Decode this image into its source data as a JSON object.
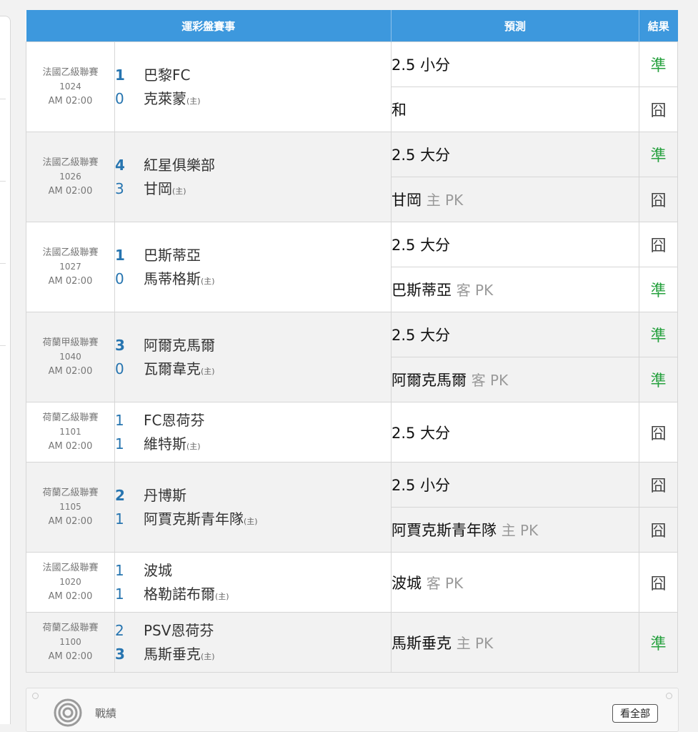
{
  "table": {
    "headers": {
      "match": "運彩盤賽事",
      "prediction": "預測",
      "result": "結果"
    },
    "host_marker": "(主)",
    "rows": [
      {
        "league": "法國乙級聯賽",
        "date": "1024",
        "time": "AM 02:00",
        "teams": [
          {
            "score": "1",
            "name": "巴黎FC",
            "host": false,
            "win": true
          },
          {
            "score": "0",
            "name": "克萊蒙",
            "host": true,
            "win": false
          }
        ],
        "predictions": [
          {
            "text": "2.5 小分",
            "side": "",
            "kind": "",
            "result": "準",
            "ok": true
          },
          {
            "text": "和",
            "side": "",
            "kind": "",
            "result": "囧",
            "ok": false
          }
        ]
      },
      {
        "league": "法國乙級聯賽",
        "date": "1026",
        "time": "AM 02:00",
        "teams": [
          {
            "score": "4",
            "name": "紅星俱樂部",
            "host": false,
            "win": true
          },
          {
            "score": "3",
            "name": "甘岡",
            "host": true,
            "win": false
          }
        ],
        "predictions": [
          {
            "text": "2.5 大分",
            "side": "",
            "kind": "",
            "result": "準",
            "ok": true
          },
          {
            "text": "",
            "side": "甘岡",
            "kind": "主 PK",
            "result": "囧",
            "ok": false
          }
        ]
      },
      {
        "league": "法國乙級聯賽",
        "date": "1027",
        "time": "AM 02:00",
        "teams": [
          {
            "score": "1",
            "name": "巴斯蒂亞",
            "host": false,
            "win": true
          },
          {
            "score": "0",
            "name": "馬蒂格斯",
            "host": true,
            "win": false
          }
        ],
        "predictions": [
          {
            "text": "2.5 大分",
            "side": "",
            "kind": "",
            "result": "囧",
            "ok": false
          },
          {
            "text": "",
            "side": "巴斯蒂亞",
            "kind": "客 PK",
            "result": "準",
            "ok": true
          }
        ]
      },
      {
        "league": "荷蘭甲級聯賽",
        "date": "1040",
        "time": "AM 02:00",
        "teams": [
          {
            "score": "3",
            "name": "阿爾克馬爾",
            "host": false,
            "win": true
          },
          {
            "score": "0",
            "name": "瓦爾韋克",
            "host": true,
            "win": false
          }
        ],
        "predictions": [
          {
            "text": "2.5 大分",
            "side": "",
            "kind": "",
            "result": "準",
            "ok": true
          },
          {
            "text": "",
            "side": "阿爾克馬爾",
            "kind": "客 PK",
            "result": "準",
            "ok": true
          }
        ]
      },
      {
        "league": "荷蘭乙級聯賽",
        "date": "1101",
        "time": "AM 02:00",
        "teams": [
          {
            "score": "1",
            "name": "FC恩荷芬",
            "host": false,
            "win": false
          },
          {
            "score": "1",
            "name": "維特斯",
            "host": true,
            "win": false
          }
        ],
        "predictions": [
          {
            "text": "2.5 大分",
            "side": "",
            "kind": "",
            "result": "囧",
            "ok": false
          }
        ]
      },
      {
        "league": "荷蘭乙級聯賽",
        "date": "1105",
        "time": "AM 02:00",
        "teams": [
          {
            "score": "2",
            "name": "丹博斯",
            "host": false,
            "win": true
          },
          {
            "score": "1",
            "name": "阿賈克斯青年隊",
            "host": true,
            "win": false
          }
        ],
        "predictions": [
          {
            "text": "2.5 小分",
            "side": "",
            "kind": "",
            "result": "囧",
            "ok": false
          },
          {
            "text": "",
            "side": "阿賈克斯青年隊",
            "kind": "主 PK",
            "result": "囧",
            "ok": false
          }
        ]
      },
      {
        "league": "法國乙級聯賽",
        "date": "1020",
        "time": "AM 02:00",
        "teams": [
          {
            "score": "1",
            "name": "波城",
            "host": false,
            "win": false
          },
          {
            "score": "1",
            "name": "格勒諾布爾",
            "host": true,
            "win": false
          }
        ],
        "predictions": [
          {
            "text": "",
            "side": "波城",
            "kind": "客 PK",
            "result": "囧",
            "ok": false
          }
        ]
      },
      {
        "league": "荷蘭乙級聯賽",
        "date": "1100",
        "time": "AM 02:00",
        "teams": [
          {
            "score": "2",
            "name": "PSV恩荷芬",
            "host": false,
            "win": false
          },
          {
            "score": "3",
            "name": "馬斯垂克",
            "host": true,
            "win": true
          }
        ],
        "predictions": [
          {
            "text": "",
            "side": "馬斯垂克",
            "kind": "主 PK",
            "result": "準",
            "ok": true
          }
        ]
      }
    ]
  },
  "colors": {
    "header": "#3d98dd",
    "ok": "#27a13f",
    "miss": "#444444",
    "score": "#2775b0"
  },
  "panel": {
    "title": "戰績",
    "view_all_label": "看全部",
    "icon": "target-icon"
  }
}
